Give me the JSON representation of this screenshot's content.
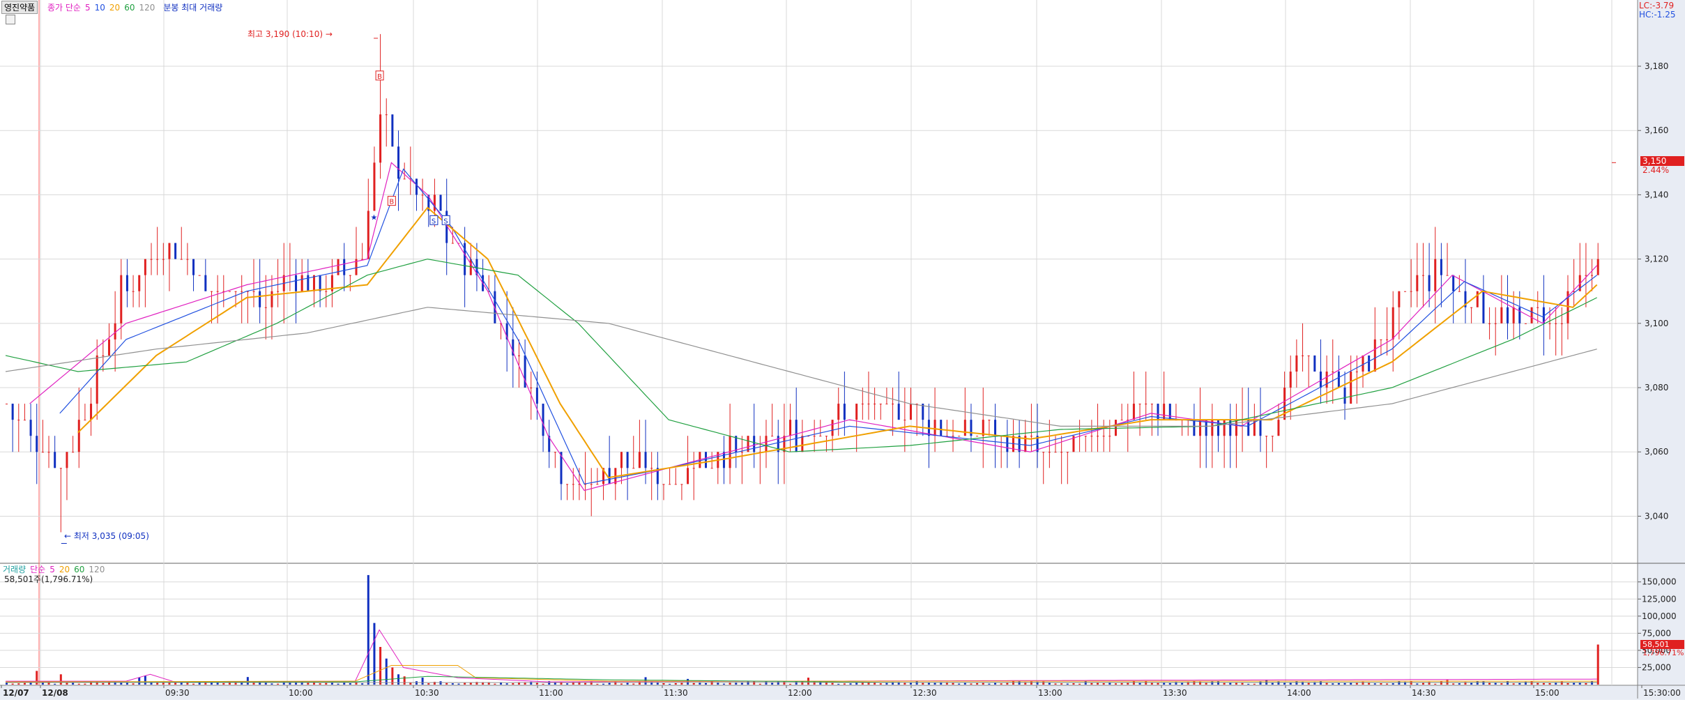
{
  "price_panel": {
    "stock_name": "영진약품",
    "legend": {
      "ma_label": "종가 단순",
      "periods": [
        {
          "label": "5",
          "color": "#e020c0"
        },
        {
          "label": "10",
          "color": "#2050e0"
        },
        {
          "label": "20",
          "color": "#f0a000"
        },
        {
          "label": "60",
          "color": "#20a040"
        },
        {
          "label": "120",
          "color": "#909090"
        }
      ],
      "extra": "분봉 최대 거래량"
    },
    "right_labels": {
      "lc": "LC:-3.79",
      "hc": "HC:-1.25"
    },
    "last_price_tag": {
      "value": "3,150",
      "change": "2.44%"
    },
    "annotations": {
      "high": "최고 3,190 (10:10) →",
      "low": "← 최저 3,035 (09:05)"
    },
    "signal_marks": {
      "buy": "B",
      "sell": "S"
    }
  },
  "volume_panel": {
    "legend": {
      "title": "거래량",
      "ma_label": "단순",
      "periods": [
        {
          "label": "5",
          "color": "#e020c0"
        },
        {
          "label": "20",
          "color": "#f0a000"
        },
        {
          "label": "60",
          "color": "#20a040"
        },
        {
          "label": "120",
          "color": "#909090"
        }
      ]
    },
    "last_volume_text": "58,501주(1,796.71%)",
    "last_volume_tag": {
      "value": "58,501",
      "pct": "1,796.71%"
    }
  },
  "x_axis": {
    "labels": [
      "12/07",
      "12/08",
      "09:30",
      "10:00",
      "10:30",
      "11:00",
      "11:30",
      "12:00",
      "12:30",
      "13:00",
      "13:30",
      "14:00",
      "14:30",
      "15:00",
      "15:30:00"
    ]
  },
  "colors": {
    "up": "#e02020",
    "down": "#1030c0",
    "grid": "#d8d8d8",
    "axis_bg": "#e8ecf4"
  },
  "chart_data": [
    {
      "type": "candlestick",
      "title": "영진약품",
      "y_ticks": [
        3040,
        3060,
        3080,
        3100,
        3120,
        3140,
        3160,
        3180
      ],
      "y_tick_labels": [
        "3,040",
        "3,060",
        "3,080",
        "3,100",
        "3,120",
        "3,140",
        "3,160",
        "3,180"
      ],
      "ylim": [
        3026,
        3198
      ],
      "x_labels": [
        "12/07",
        "12/08",
        "09:30",
        "10:00",
        "10:30",
        "11:00",
        "11:30",
        "12:00",
        "12:30",
        "13:00",
        "13:30",
        "14:00",
        "14:30",
        "15:00",
        "15:30:00"
      ],
      "prev_day_close": 3075,
      "close_path": [
        [
          0,
          3075
        ],
        [
          9,
          3055
        ],
        [
          12,
          3068
        ],
        [
          16,
          3090
        ],
        [
          19,
          3110
        ],
        [
          23,
          3118
        ],
        [
          27,
          3125
        ],
        [
          30,
          3120
        ],
        [
          34,
          3108
        ],
        [
          38,
          3112
        ],
        [
          42,
          3105
        ],
        [
          46,
          3115
        ],
        [
          50,
          3110
        ],
        [
          54,
          3113
        ],
        [
          59,
          3122
        ],
        [
          62,
          3165
        ],
        [
          65,
          3150
        ],
        [
          68,
          3140
        ],
        [
          71,
          3135
        ],
        [
          74,
          3125
        ],
        [
          77,
          3115
        ],
        [
          80,
          3110
        ],
        [
          83,
          3095
        ],
        [
          86,
          3085
        ],
        [
          89,
          3070
        ],
        [
          92,
          3055
        ],
        [
          95,
          3048
        ],
        [
          98,
          3052
        ],
        [
          102,
          3058
        ],
        [
          106,
          3055
        ],
        [
          110,
          3052
        ],
        [
          114,
          3056
        ],
        [
          118,
          3060
        ],
        [
          122,
          3058
        ],
        [
          126,
          3062
        ],
        [
          130,
          3065
        ],
        [
          134,
          3068
        ],
        [
          138,
          3070
        ],
        [
          142,
          3075
        ],
        [
          146,
          3072
        ],
        [
          150,
          3074
        ],
        [
          154,
          3068
        ],
        [
          158,
          3065
        ],
        [
          162,
          3068
        ],
        [
          166,
          3062
        ],
        [
          170,
          3060
        ],
        [
          174,
          3058
        ],
        [
          178,
          3062
        ],
        [
          182,
          3068
        ],
        [
          186,
          3072
        ],
        [
          190,
          3075
        ],
        [
          194,
          3070
        ],
        [
          198,
          3067
        ],
        [
          202,
          3068
        ],
        [
          206,
          3068
        ],
        [
          210,
          3070
        ],
        [
          214,
          3088
        ],
        [
          218,
          3085
        ],
        [
          222,
          3080
        ],
        [
          226,
          3090
        ],
        [
          230,
          3102
        ],
        [
          234,
          3115
        ],
        [
          238,
          3115
        ],
        [
          242,
          3108
        ],
        [
          246,
          3102
        ],
        [
          250,
          3100
        ],
        [
          254,
          3102
        ],
        [
          258,
          3100
        ],
        [
          261,
          3112
        ],
        [
          263,
          3118
        ],
        [
          264,
          3120
        ]
      ],
      "high": {
        "value": 3190,
        "time": "10:10"
      },
      "low": {
        "value": 3035,
        "time": "09:05"
      },
      "last": {
        "value": 3150,
        "change_pct": 2.44
      },
      "series": [
        {
          "name": "5",
          "color": "#e020c0",
          "path": [
            [
              4,
              3075
            ],
            [
              20,
              3100
            ],
            [
              40,
              3112
            ],
            [
              60,
              3120
            ],
            [
              64,
              3150
            ],
            [
              70,
              3140
            ],
            [
              80,
              3110
            ],
            [
              90,
              3065
            ],
            [
              96,
              3048
            ],
            [
              110,
              3055
            ],
            [
              140,
              3070
            ],
            [
              170,
              3060
            ],
            [
              190,
              3072
            ],
            [
              205,
              3068
            ],
            [
              230,
              3095
            ],
            [
              240,
              3115
            ],
            [
              255,
              3100
            ],
            [
              264,
              3118
            ]
          ]
        },
        {
          "name": "10",
          "color": "#2050e0",
          "path": [
            [
              9,
              3072
            ],
            [
              20,
              3095
            ],
            [
              40,
              3110
            ],
            [
              60,
              3118
            ],
            [
              66,
              3148
            ],
            [
              74,
              3130
            ],
            [
              85,
              3095
            ],
            [
              96,
              3050
            ],
            [
              110,
              3055
            ],
            [
              140,
              3068
            ],
            [
              170,
              3062
            ],
            [
              190,
              3071
            ],
            [
              206,
              3068
            ],
            [
              230,
              3092
            ],
            [
              242,
              3113
            ],
            [
              255,
              3102
            ],
            [
              264,
              3115
            ]
          ]
        },
        {
          "name": "20",
          "color": "#f0a000",
          "path": [
            [
              12,
              3066
            ],
            [
              25,
              3090
            ],
            [
              40,
              3108
            ],
            [
              60,
              3112
            ],
            [
              70,
              3136
            ],
            [
              80,
              3120
            ],
            [
              92,
              3075
            ],
            [
              100,
              3052
            ],
            [
              120,
              3058
            ],
            [
              150,
              3068
            ],
            [
              170,
              3064
            ],
            [
              190,
              3070
            ],
            [
              210,
              3070
            ],
            [
              230,
              3088
            ],
            [
              245,
              3110
            ],
            [
              260,
              3105
            ],
            [
              264,
              3112
            ]
          ]
        },
        {
          "name": "60",
          "color": "#20a040",
          "path": [
            [
              0,
              3090
            ],
            [
              12,
              3085
            ],
            [
              30,
              3088
            ],
            [
              45,
              3100
            ],
            [
              60,
              3115
            ],
            [
              70,
              3120
            ],
            [
              85,
              3115
            ],
            [
              95,
              3100
            ],
            [
              110,
              3070
            ],
            [
              130,
              3060
            ],
            [
              150,
              3062
            ],
            [
              175,
              3067
            ],
            [
              200,
              3068
            ],
            [
              230,
              3080
            ],
            [
              250,
              3095
            ],
            [
              264,
              3108
            ]
          ]
        },
        {
          "name": "120",
          "color": "#909090",
          "path": [
            [
              0,
              3085
            ],
            [
              25,
              3092
            ],
            [
              50,
              3097
            ],
            [
              70,
              3105
            ],
            [
              100,
              3100
            ],
            [
              130,
              3085
            ],
            [
              150,
              3075
            ],
            [
              175,
              3068
            ],
            [
              200,
              3068
            ],
            [
              230,
              3075
            ],
            [
              250,
              3085
            ],
            [
              264,
              3092
            ]
          ]
        }
      ]
    },
    {
      "type": "bar",
      "title": "거래량",
      "y_ticks": [
        25000,
        50000,
        75000,
        100000,
        125000,
        150000
      ],
      "y_tick_labels": [
        "25,000",
        "50,000",
        "75,000",
        "100,000",
        "125,000",
        "150,000"
      ],
      "ylim": [
        0,
        165000
      ],
      "spikes": [
        [
          5,
          20000
        ],
        [
          9,
          15000
        ],
        [
          23,
          13000
        ],
        [
          60,
          160000
        ],
        [
          61,
          90000
        ],
        [
          62,
          55000
        ],
        [
          63,
          38000
        ],
        [
          64,
          25000
        ],
        [
          65,
          15000
        ],
        [
          66,
          12000
        ],
        [
          264,
          58501
        ]
      ],
      "series": [
        {
          "name": "5",
          "color": "#e020c0",
          "path": [
            [
              0,
              5000
            ],
            [
              20,
              5000
            ],
            [
              24,
              15000
            ],
            [
              28,
              4000
            ],
            [
              58,
              5000
            ],
            [
              62,
              80000
            ],
            [
              66,
              25000
            ],
            [
              75,
              10000
            ],
            [
              90,
              4000
            ],
            [
              264,
              8000
            ]
          ]
        },
        {
          "name": "20",
          "color": "#f0a000",
          "path": [
            [
              0,
              4000
            ],
            [
              58,
              5000
            ],
            [
              64,
              28000
            ],
            [
              75,
              28000
            ],
            [
              78,
              10000
            ],
            [
              100,
              5000
            ],
            [
              264,
              5000
            ]
          ]
        },
        {
          "name": "60",
          "color": "#20a040",
          "path": [
            [
              0,
              3000
            ],
            [
              58,
              4000
            ],
            [
              70,
              12000
            ],
            [
              100,
              7000
            ],
            [
              150,
              3000
            ],
            [
              264,
              3000
            ]
          ]
        },
        {
          "name": "120",
          "color": "#909090",
          "path": [
            [
              0,
              3000
            ],
            [
              264,
              3000
            ]
          ]
        }
      ],
      "last": {
        "value": 58501,
        "pct": 1796.71
      }
    }
  ]
}
